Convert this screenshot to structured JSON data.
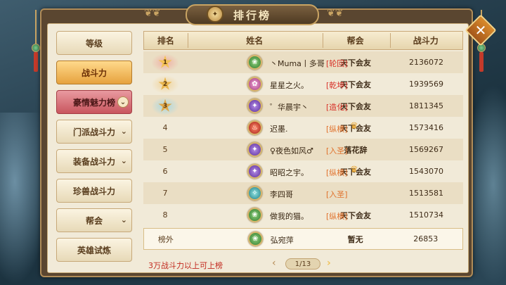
{
  "window": {
    "title": "排行榜"
  },
  "menu": {
    "items": [
      {
        "label": "等级",
        "state": "normal",
        "has_chevron": false
      },
      {
        "label": "战斗力",
        "state": "active",
        "has_chevron": false
      },
      {
        "label": "豪情魅力榜",
        "state": "pink",
        "has_chevron": true
      },
      {
        "label": "门派战斗力",
        "state": "normal",
        "has_chevron": true
      },
      {
        "label": "装备战斗力",
        "state": "normal",
        "has_chevron": true
      },
      {
        "label": "珍兽战斗力",
        "state": "normal",
        "has_chevron": false
      },
      {
        "label": "帮会",
        "state": "normal",
        "has_chevron": true
      },
      {
        "label": "英雄试炼",
        "state": "normal",
        "has_chevron": false
      }
    ]
  },
  "table": {
    "headers": {
      "rank": "排名",
      "name": "姓名",
      "guild": "帮会",
      "power": "战斗力"
    },
    "rows": [
      {
        "rank": "1",
        "medal": true,
        "avatar": "green",
        "name": "丶Muma丨多哥",
        "faction": "[轮回]",
        "faction_color": "red",
        "crown": false,
        "guild": "天下会友",
        "power": "2136072"
      },
      {
        "rank": "2",
        "medal": true,
        "avatar": "pink",
        "name": "星星之火。",
        "faction": "[乾坤]",
        "faction_color": "red",
        "crown": false,
        "guild": "天下会友",
        "power": "1939569"
      },
      {
        "rank": "3",
        "medal": true,
        "avatar": "purple",
        "name": "゜华晨宇丶",
        "faction": "[造化]",
        "faction_color": "red",
        "crown": false,
        "guild": "天下会友",
        "power": "1811345"
      },
      {
        "rank": "4",
        "medal": false,
        "avatar": "red",
        "name": "迟墨.",
        "faction": "[纵横]",
        "faction_color": "orange",
        "crown": true,
        "guild": "天下会友",
        "power": "1573416"
      },
      {
        "rank": "5",
        "medal": false,
        "avatar": "purple",
        "name": "♀夜色如风♂",
        "faction": "[入圣]",
        "faction_color": "orange",
        "crown": false,
        "guild": "落花辞",
        "power": "1569267"
      },
      {
        "rank": "6",
        "medal": false,
        "avatar": "purple",
        "name": "昭昭之宇。",
        "faction": "[纵横]",
        "faction_color": "orange",
        "crown": true,
        "guild": "天下会友",
        "power": "1543070"
      },
      {
        "rank": "7",
        "medal": false,
        "avatar": "teal",
        "name": "李四哥",
        "faction": "[入圣]",
        "faction_color": "orange",
        "crown": false,
        "guild": "",
        "power": "1513581"
      },
      {
        "rank": "8",
        "medal": false,
        "avatar": "green",
        "name": "做我的猫。",
        "faction": "[纵横]",
        "faction_color": "orange",
        "crown": false,
        "guild": "天下会友",
        "power": "1510734"
      }
    ],
    "self_row": {
      "rank": "榜外",
      "avatar": "green",
      "name": "弘宛萍",
      "guild": "暂无",
      "power": "26853"
    }
  },
  "footer": {
    "note": "3万战斗力以上可上榜",
    "page": "1/13",
    "prev_icon": "chevron-left-icon",
    "next_icon": "chevron-right-icon"
  },
  "colors": {
    "faction_red": "#d8332a",
    "faction_orange": "#e0702a",
    "active_tab": "#e6a23e",
    "pink_tab": "#c9565e"
  }
}
